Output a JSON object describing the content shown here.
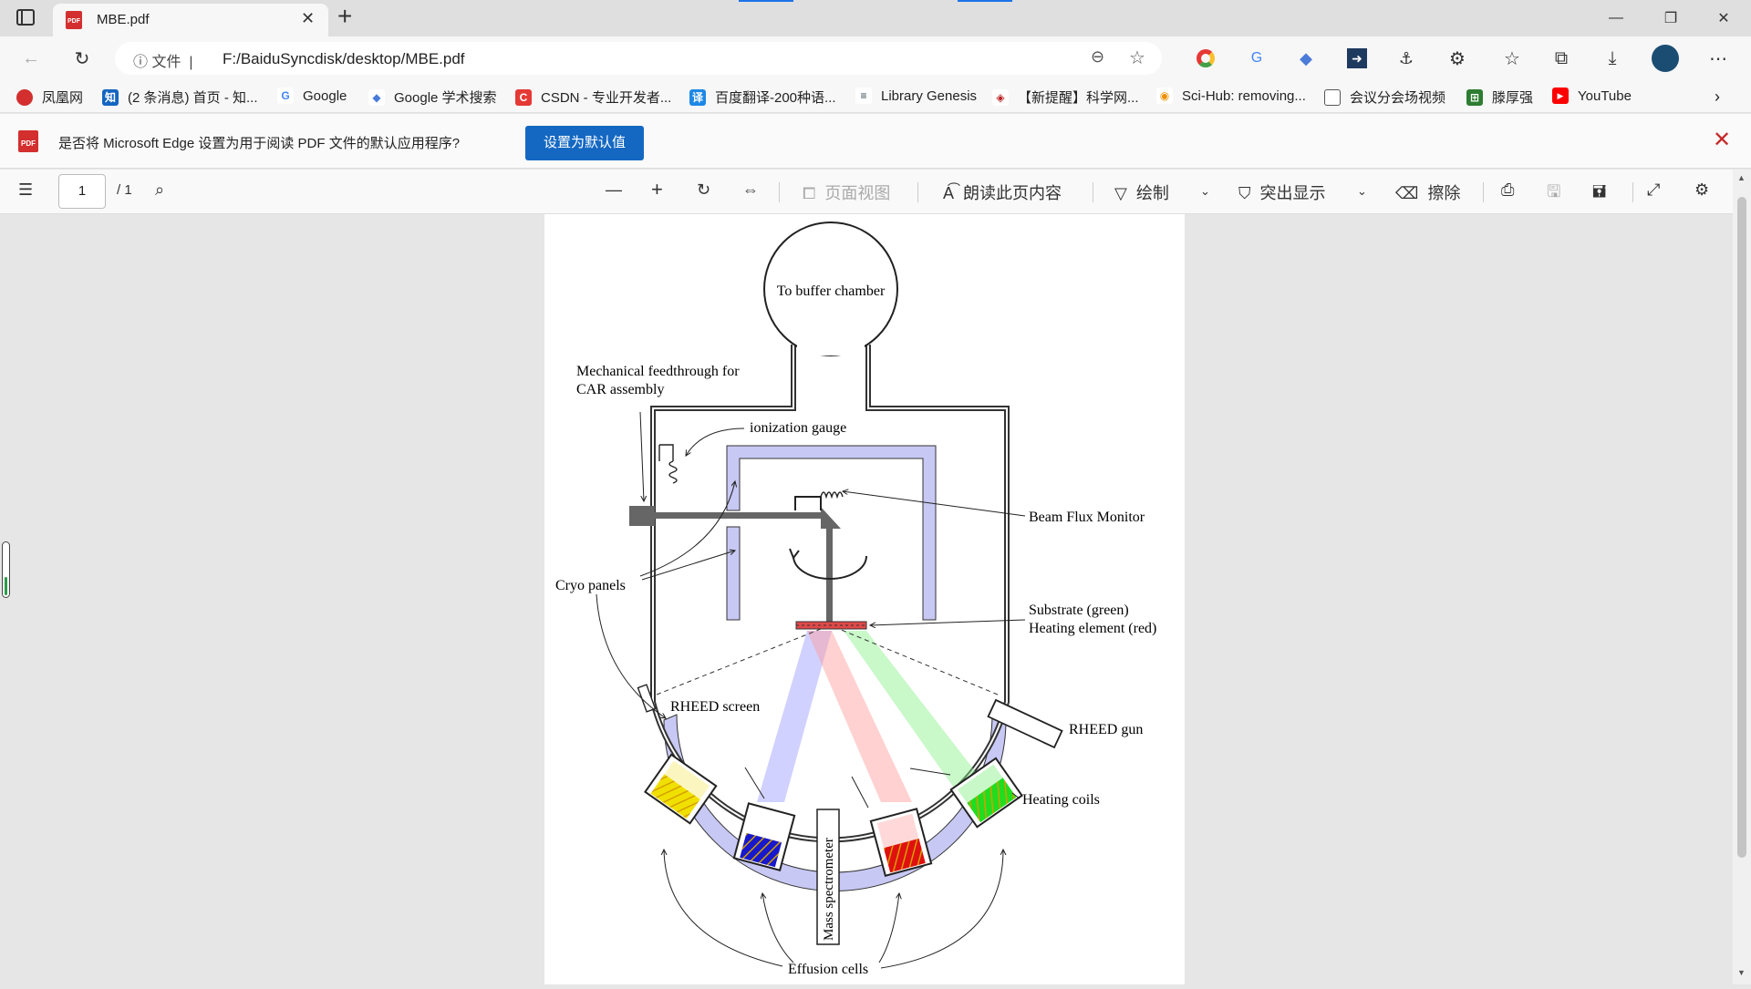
{
  "browser": {
    "tab_title": "MBE.pdf",
    "new_tab": "+",
    "address_prefix": "文件",
    "url": "F:/BaiduSyncdisk/desktop/MBE.pdf"
  },
  "bookmarks": [
    {
      "label": "凤凰网",
      "icon": "phoenix-icon",
      "color": "#d32f2f"
    },
    {
      "label": "(2 条消息) 首页 - 知...",
      "icon": "zhihu-icon",
      "color": "#1565c0"
    },
    {
      "label": "Google",
      "icon": "google-icon",
      "color": "#4285f4"
    },
    {
      "label": "Google 学术搜索",
      "icon": "scholar-icon",
      "color": "#4a7bd9"
    },
    {
      "label": "CSDN - 专业开发者...",
      "icon": "csdn-icon",
      "color": "#e53935"
    },
    {
      "label": "百度翻译-200种语...",
      "icon": "baidu-translate-icon",
      "color": "#1e88e5"
    },
    {
      "label": "Library Genesis",
      "icon": "libgen-icon",
      "color": "#37474f"
    },
    {
      "label": "【新提醒】科学网...",
      "icon": "sciencenet-icon",
      "color": "#b71c1c"
    },
    {
      "label": "Sci-Hub: removing...",
      "icon": "scihub-icon",
      "color": "#ef8f00"
    },
    {
      "label": "会议分会场视频",
      "icon": "document-icon",
      "color": "#666666"
    },
    {
      "label": "滕厚强",
      "icon": "sheet-icon",
      "color": "#2e7d32"
    },
    {
      "label": "YouTube",
      "icon": "youtube-icon",
      "color": "#ff0000"
    }
  ],
  "infobar": {
    "message": "是否将 Microsoft Edge 设置为用于阅读 PDF 文件的默认应用程序?",
    "button": "设置为默认值"
  },
  "pdf_toolbar": {
    "page_current": "1",
    "page_total": "/ 1",
    "page_view": "页面视图",
    "read_aloud": "朗读此页内容",
    "draw": "绘制",
    "highlight": "突出显示",
    "erase": "擦除"
  },
  "diagram": {
    "buffer_chamber": "To buffer chamber",
    "feedthrough_line1": "Mechanical feedthrough for",
    "feedthrough_line2": "CAR assembly",
    "ionization_gauge": "ionization gauge",
    "beam_flux_monitor": "Beam Flux Monitor",
    "cryo_panels": "Cryo panels",
    "substrate_line1": "Substrate (green)",
    "substrate_line2": "Heating element (red)",
    "rheed_screen": "RHEED screen",
    "rheed_gun": "RHEED gun",
    "heating_coils": "Heating coils",
    "mass_spectrometer": "Mass spectrometer",
    "effusion_cells": "Effusion cells"
  }
}
